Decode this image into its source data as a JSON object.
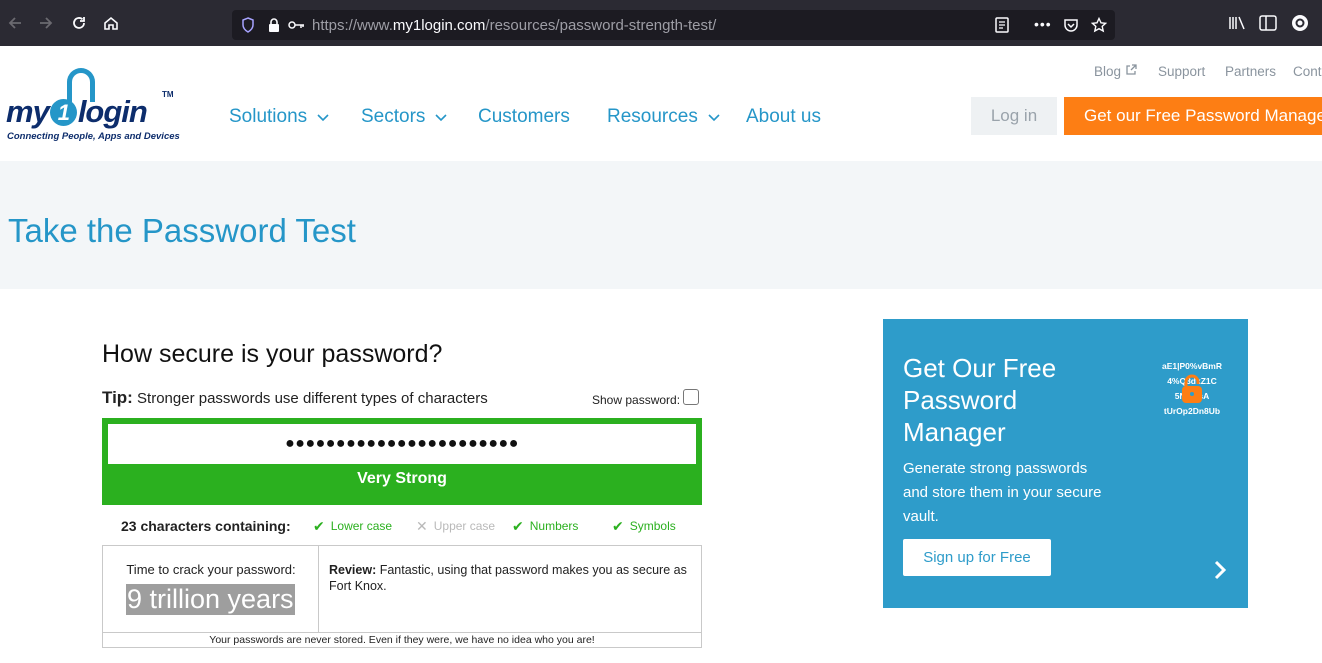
{
  "browser": {
    "url_prefix": "https://www.",
    "url_host": "my1login.com",
    "url_path": "/resources/password-strength-test/"
  },
  "header": {
    "logo": {
      "part1": "my",
      "part2": "1",
      "part3": "login",
      "tm": "TM",
      "tagline": "Connecting People, Apps and Devices"
    },
    "nav": [
      {
        "label": "Solutions"
      },
      {
        "label": "Sectors"
      },
      {
        "label": "Customers"
      },
      {
        "label": "Resources"
      },
      {
        "label": "About us"
      }
    ],
    "utility": [
      "Blog",
      "Support",
      "Partners",
      "Conta"
    ],
    "login_label": "Log in",
    "cta_label": "Get our Free Password Manager"
  },
  "hero": {
    "title": "Take the Password Test"
  },
  "test": {
    "question": "How secure is your password?",
    "tip_label": "Tip:",
    "tip_text": " Stronger passwords use different types of characters",
    "show_password_label": "Show password:",
    "masked_password": "●●●●●●●●●●●●●●●●●●●●●●●",
    "strength": "Very Strong",
    "chars_count": "23 characters containing:",
    "criteria": [
      {
        "label": "Lower case",
        "met": true
      },
      {
        "label": "Upper case",
        "met": false
      },
      {
        "label": "Numbers",
        "met": true
      },
      {
        "label": "Symbols",
        "met": true
      }
    ],
    "crack_label": "Time to crack your password:",
    "crack_time": "9 trillion years",
    "review_label": "Review:",
    "review_text": " Fantastic, using that password makes you as secure as Fort Knox.",
    "footnote": "Your passwords are never stored. Even if they were, we have no idea who you are!"
  },
  "promo": {
    "title": "Get Our Free Password Manager",
    "description": "Generate strong passwords and store them in your secure vault.",
    "signup_label": "Sign up for Free",
    "graphic_lines": [
      "aE1|P0%vBmR",
      "4%Q3dkZ1C",
      "5NT  dsA",
      "tUrOp2Dn8Ub"
    ]
  },
  "colors": {
    "brand_blue": "#2596c8",
    "cta_orange": "#fd7e14",
    "strength_green": "#2bb01f"
  }
}
